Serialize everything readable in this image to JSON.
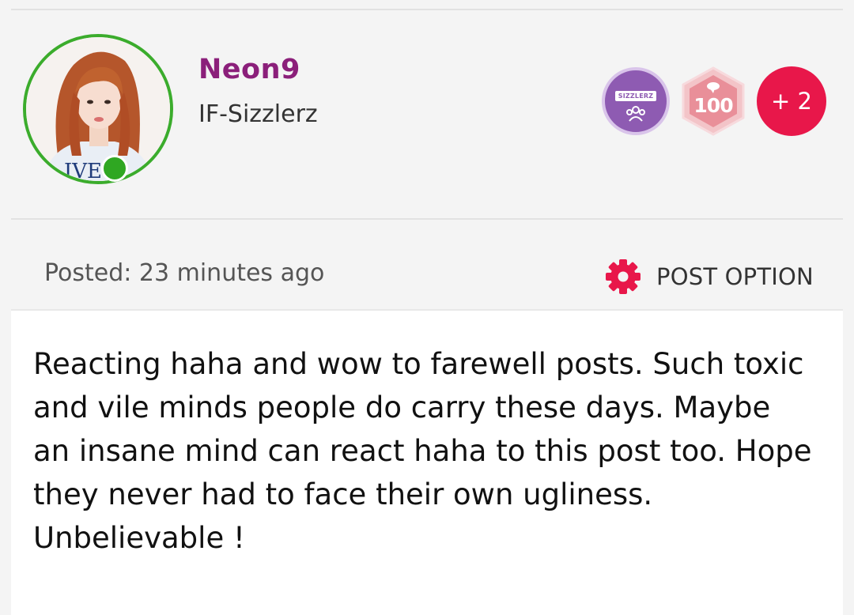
{
  "profile": {
    "username": "Neon9",
    "group": "IF-Sizzlerz",
    "avatar_shirt_text": "IVE",
    "online": true
  },
  "badges": {
    "group_badge_text": "SIZZLERZ",
    "level_badge_value": "100",
    "more_count": "+ 2"
  },
  "post": {
    "posted_label": "Posted: 23 minutes ago",
    "option_label": "POST OPTION",
    "option_icon": "gear-icon",
    "text": "Reacting haha and wow to farewell posts. Such toxic and vile minds people do carry these days. Maybe an insane mind can react haha to this post too. Hope they never had to face their own ugliness. Unbelievable !"
  },
  "colors": {
    "username": "#8b1f7a",
    "online": "#2fa722",
    "accent": "#e8174a",
    "group_badge": "#8e5bb2",
    "level_badge": "#e98f99"
  }
}
